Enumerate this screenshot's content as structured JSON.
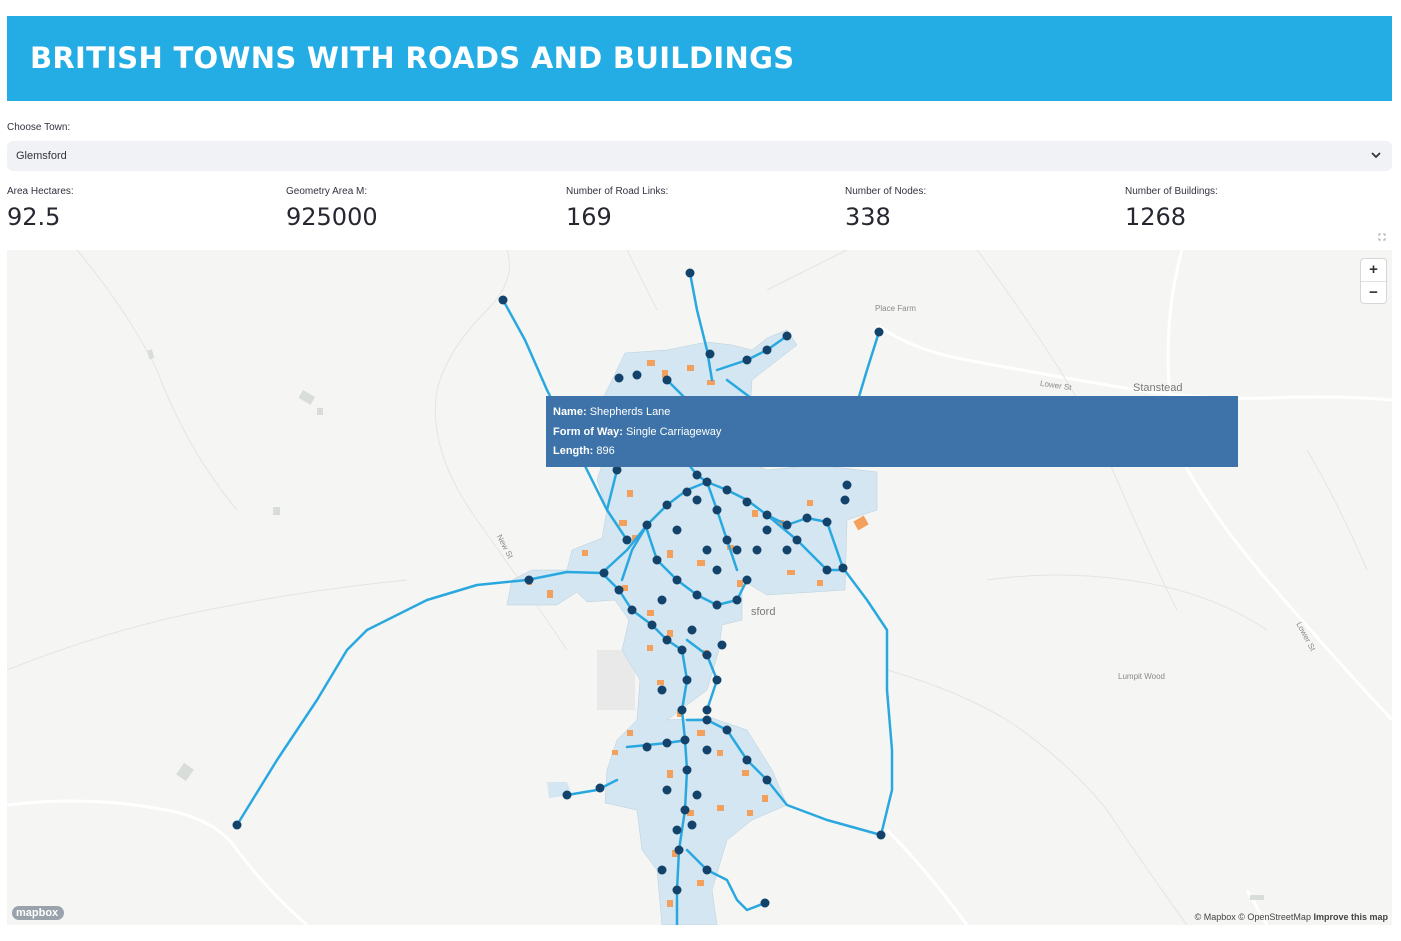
{
  "header": {
    "title": "BRITISH TOWNS WITH ROADS AND BUILDINGS"
  },
  "town_select": {
    "label": "Choose Town:",
    "value": "Glemsford"
  },
  "metrics": [
    {
      "label": "Area Hectares:",
      "value": "92.5"
    },
    {
      "label": "Geometry Area M:",
      "value": "925000"
    },
    {
      "label": "Number of Road Links:",
      "value": "169"
    },
    {
      "label": "Number of Nodes:",
      "value": "338"
    },
    {
      "label": "Number of Buildings:",
      "value": "1268"
    }
  ],
  "map": {
    "zoom_in": "+",
    "zoom_out": "−",
    "tooltip": {
      "name_label": "Name:",
      "name_value": "Shepherds Lane",
      "form_label": "Form of Way:",
      "form_value": "Single Carriageway",
      "length_label": "Length:",
      "length_value": "896"
    },
    "places": {
      "place_farm": "Place Farm",
      "lower_st_1": "Lower St",
      "stanstead": "Stanstead",
      "new_st": "New St",
      "lumpit_wood": "Lumpit Wood",
      "lower_st_2": "Lower St",
      "town_suffix": "sford"
    },
    "attribution": {
      "a": "© Mapbox © OpenStreetMap",
      "improve": "Improve this map"
    },
    "logo": "mapbox",
    "colors": {
      "road": "#29a8e0",
      "node": "#13426b",
      "building": "#f2a05c",
      "town_area": "#d3e6f1",
      "tooltip_bg": "#3d73a8",
      "banner": "#24ade5"
    },
    "icons": [
      "fullscreen-icon",
      "chevron-down-icon",
      "mapbox-logo-icon"
    ]
  }
}
